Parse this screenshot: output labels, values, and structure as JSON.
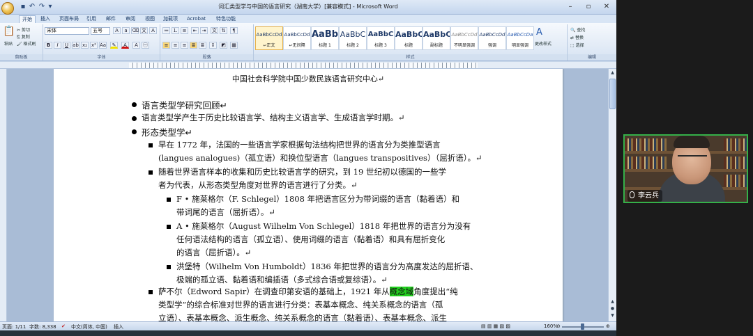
{
  "window": {
    "title": "词汇类型学与中国的语言研究（湖南大学）[兼容模式] - Microsoft Word"
  },
  "tabs": [
    "开始",
    "插入",
    "页面布局",
    "引用",
    "邮件",
    "审阅",
    "视图",
    "加载项",
    "Acrobat",
    "特色功能"
  ],
  "ribbon": {
    "clipboard": {
      "paste": "粘贴",
      "cut": "剪切",
      "copy": "复制",
      "format_painter": "格式刷",
      "label": "剪贴板"
    },
    "font": {
      "name": "宋体",
      "size": "五号",
      "label": "字体"
    },
    "paragraph": {
      "label": "段落"
    },
    "styles": {
      "label": "样式",
      "items": [
        {
          "preview": "AaBbCcDd",
          "name": "↵正文"
        },
        {
          "preview": "AaBbCcDd",
          "name": "↵无间隔"
        },
        {
          "preview": "AaBb",
          "name": "标题 1"
        },
        {
          "preview": "AaBbC",
          "name": "标题 2"
        },
        {
          "preview": "AaBbC",
          "name": "标题 3"
        },
        {
          "preview": "AaBbC",
          "name": "标题"
        },
        {
          "preview": "AaBbC",
          "name": "副标题"
        },
        {
          "preview": "AaBbCcDd",
          "name": "不明显强调"
        },
        {
          "preview": "AaBbCcDd",
          "name": "强调"
        },
        {
          "preview": "AaBbCcDa",
          "name": "明显强调"
        }
      ],
      "change_styles": "更改样式"
    },
    "editing": {
      "find": "查找",
      "replace": "替换",
      "select": "选择",
      "label": "编辑"
    }
  },
  "document": {
    "header": "中国社会科学院中国少数民族语言研究中心↵",
    "lines": [
      "语言类型学研究回顾↵",
      "语言类型学产生于历史比较语言学、结构主义语言学、生成语言学时期。↵",
      "形态类型学↵",
      "早在 1772 年，法国的一些语言学家根据句法结构把世界的语言分为类推型语言",
      "(langues analogues)（孤立语）和换位型语言（langues transpositives）（屈折语）。↵",
      "随着世界语言样本的收集和历史比较语言学的研究，到 19 世纪初以德国的一些学",
      "者为代表，从形态类型角度对世界的语言进行了分类。↵",
      "F • 施莱格尔（F. Schlegel）1808 年把语言区分为带词缀的语言（黏着语）和",
      "带词尾的语言（屈折语）。↵",
      "A • 施莱格尔（August Wilhelm Von Schlegel）1818 年把世界的语言分为没有",
      "任何语法结构的语言（孤立语）、使用词缀的语言（黏着语）和具有屈折变化",
      "的语言（屈折语）。↵",
      "洪堡特（Wilhelm Von Humboldt）1836 年把世界的语言分为高度发达的屈折语、",
      "极端的孤立语、黏着语和编插语（多式综合语或复综语）。↵",
      "萨不尔（Edword Sapir）在调查印第安语的基础上，1921 年从",
      "概念域",
      "角度提出“纯",
      "类型学”的综合标准对世界的语言进行分类：表基本概念、纯关系概念的语言（孤",
      "立语）、表基本概念、派生概念、纯关系概念的语言（黏着语）、表基本概念、派生"
    ]
  },
  "status": {
    "page": "页面: 1/11",
    "words": "字数: 8,338",
    "language": "中文(简体, 中国)",
    "mode": "插入",
    "zoom": "160%",
    "zoom_value": 160
  },
  "video": {
    "participant_name": "李云兵"
  },
  "colors": {
    "highlight": "#22d11f",
    "video_border": "#35b049"
  }
}
